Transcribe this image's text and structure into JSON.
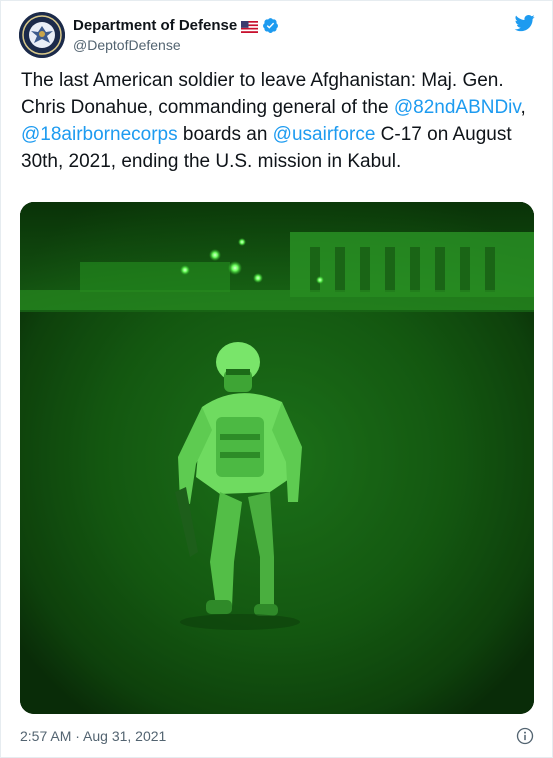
{
  "account": {
    "display_name": "Department of Defense",
    "handle": "@DeptofDefense",
    "verified": true
  },
  "tweet": {
    "segments": [
      {
        "text": "The last American soldier to leave Afghanistan: Maj. Gen. Chris Donahue, commanding general of the ",
        "mention": false
      },
      {
        "text": "@82ndABNDiv",
        "mention": true
      },
      {
        "text": ", ",
        "mention": false
      },
      {
        "text": "@18airbornecorps",
        "mention": true
      },
      {
        "text": " boards an ",
        "mention": false
      },
      {
        "text": "@usairforce",
        "mention": true
      },
      {
        "text": " C-17 on August 30th, 2021, ending the U.S. mission in Kabul.",
        "mention": false
      }
    ],
    "timestamp": "2:57 AM · Aug 31, 2021"
  },
  "icons": {
    "avatar": "dod-seal-icon",
    "flag": "us-flag-icon",
    "verified": "verified-badge-icon",
    "platform": "twitter-bird-icon",
    "info": "info-icon"
  },
  "colors": {
    "accent": "#1d9bf0",
    "text": "#0f1419",
    "secondary_text": "#536471",
    "night_vision": "#39ff3a"
  }
}
